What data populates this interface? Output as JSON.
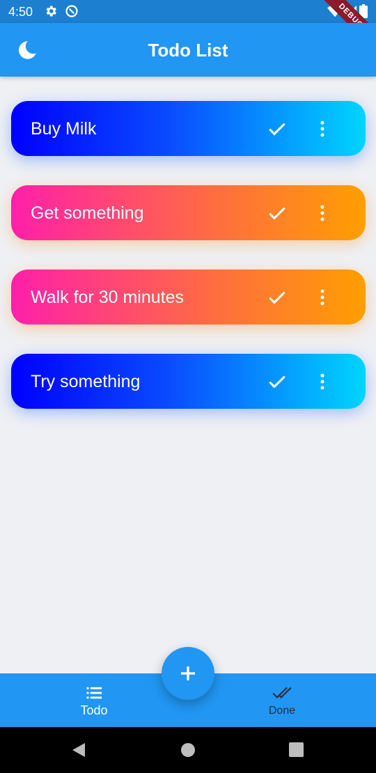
{
  "status_bar": {
    "time": "4:50",
    "debug_label": "DEBUG"
  },
  "app_bar": {
    "title": "Todo List"
  },
  "todos": [
    {
      "title": "Buy Milk",
      "style": "blue"
    },
    {
      "title": "Get something",
      "style": "orange"
    },
    {
      "title": "Walk for 30 minutes",
      "style": "orange"
    },
    {
      "title": "Try something",
      "style": "blue"
    }
  ],
  "bottom_nav": {
    "todo_label": "Todo",
    "done_label": "Done",
    "active": "todo"
  },
  "icons": {
    "theme": "moon-icon",
    "check": "check-icon",
    "more": "more-vertical-icon",
    "add": "add-icon",
    "todo_tab": "list-icon",
    "done_tab": "done-all-icon"
  },
  "colors": {
    "primary": "#2196f3",
    "status_bar": "#1c7fd0",
    "background": "#eff0f4",
    "blue_gradient_start": "#0000ff",
    "blue_gradient_end": "#00d5ff",
    "orange_gradient_start": "#ff1faa",
    "orange_gradient_end": "#ff9f00"
  }
}
